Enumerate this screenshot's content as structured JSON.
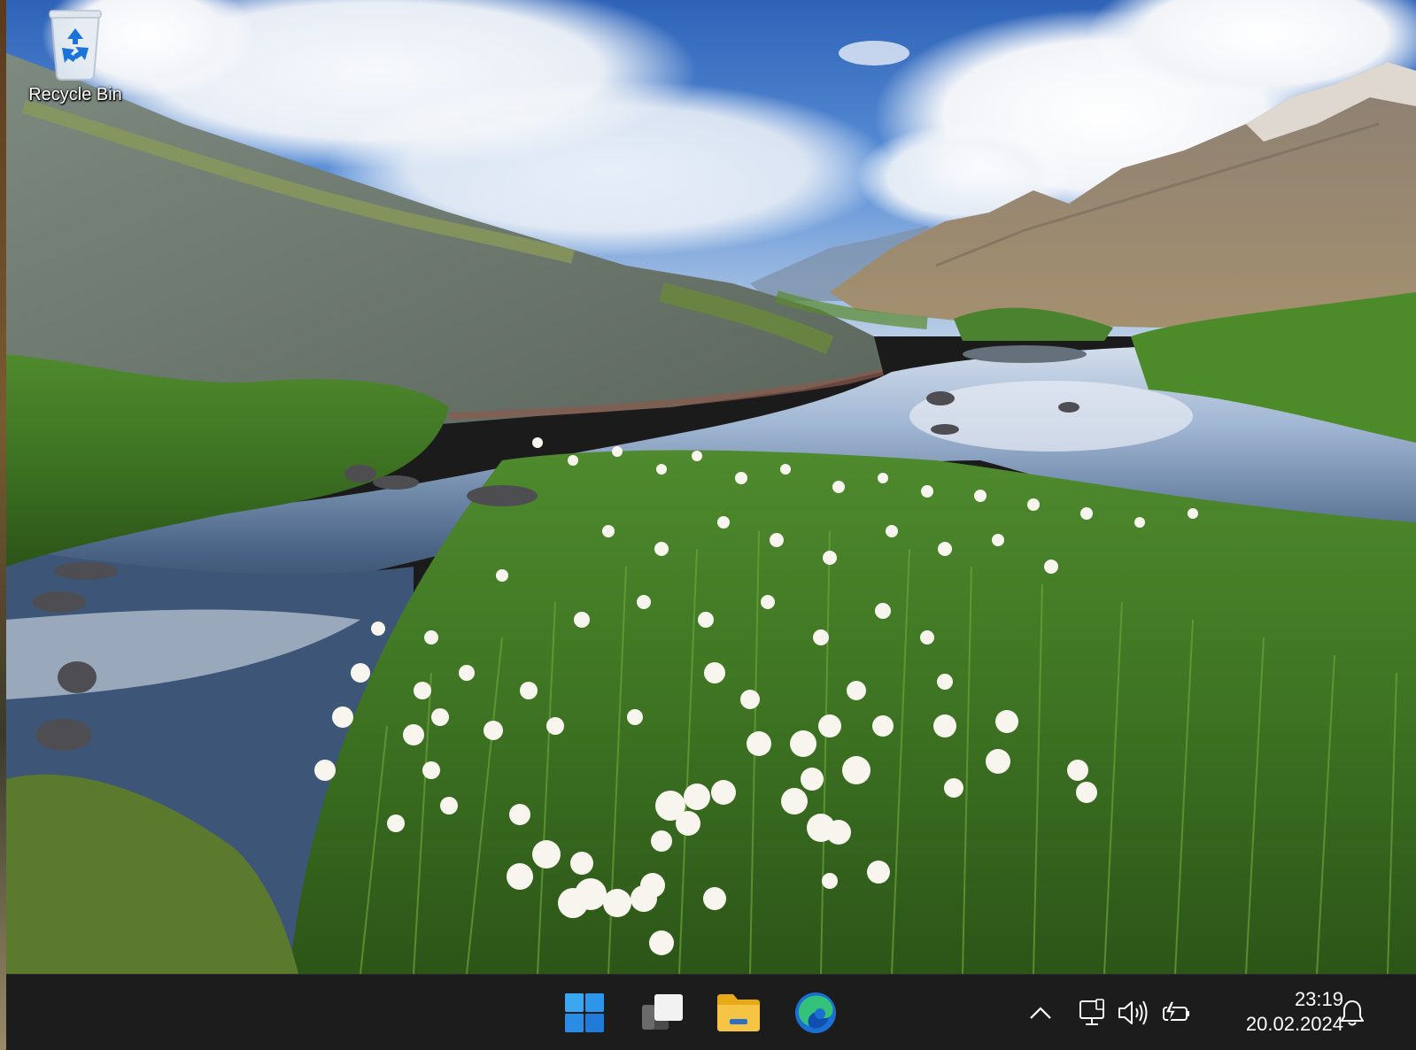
{
  "desktop": {
    "icons": [
      {
        "label": "Recycle Bin",
        "icon": "recycle-bin-icon"
      }
    ]
  },
  "taskbar": {
    "apps": [
      {
        "name": "Start",
        "icon": "windows-start-icon"
      },
      {
        "name": "Task View",
        "icon": "task-view-icon"
      },
      {
        "name": "File Explorer",
        "icon": "folder-icon"
      },
      {
        "name": "Microsoft Edge",
        "icon": "edge-icon"
      }
    ],
    "tray": {
      "icons": [
        "chevron-up-icon",
        "network-icon",
        "volume-icon",
        "battery-icon",
        "notification-bell-icon"
      ]
    },
    "clock": {
      "time": "23:19",
      "date": "20.02.2024"
    }
  },
  "colors": {
    "taskbar_bg": "#1c1c1c",
    "start_blue": "#2f8fe6",
    "folder_yellow": "#f5c242",
    "edge_teal": "#33c481"
  }
}
